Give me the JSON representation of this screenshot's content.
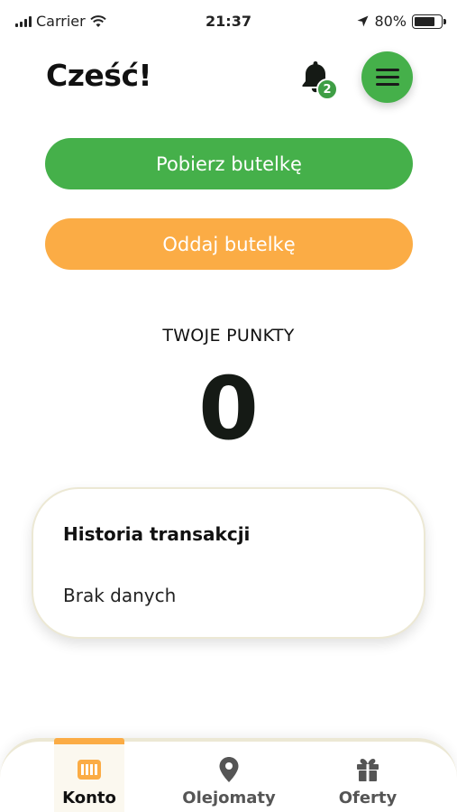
{
  "status_bar": {
    "carrier": "Carrier",
    "time": "21:37",
    "battery": "80%",
    "battery_level": 0.8
  },
  "header": {
    "greeting": "Cześć!",
    "notifications_count": "2"
  },
  "actions": {
    "get_bottle_label": "Pobierz butelkę",
    "return_bottle_label": "Oddaj butelkę"
  },
  "points": {
    "label": "TWOJE PUNKTY",
    "value": "0"
  },
  "history": {
    "title": "Historia transakcji",
    "empty_text": "Brak danych"
  },
  "tabs": [
    {
      "label": "Konto",
      "icon": "account-card-icon",
      "active": true
    },
    {
      "label": "Olejomaty",
      "icon": "location-pin-icon",
      "active": false
    },
    {
      "label": "Oferty",
      "icon": "gift-icon",
      "active": false
    }
  ],
  "colors": {
    "green": "#45b04a",
    "orange": "#fbac45",
    "badge_green": "#3e9e45",
    "card_border": "#ece8d4"
  }
}
